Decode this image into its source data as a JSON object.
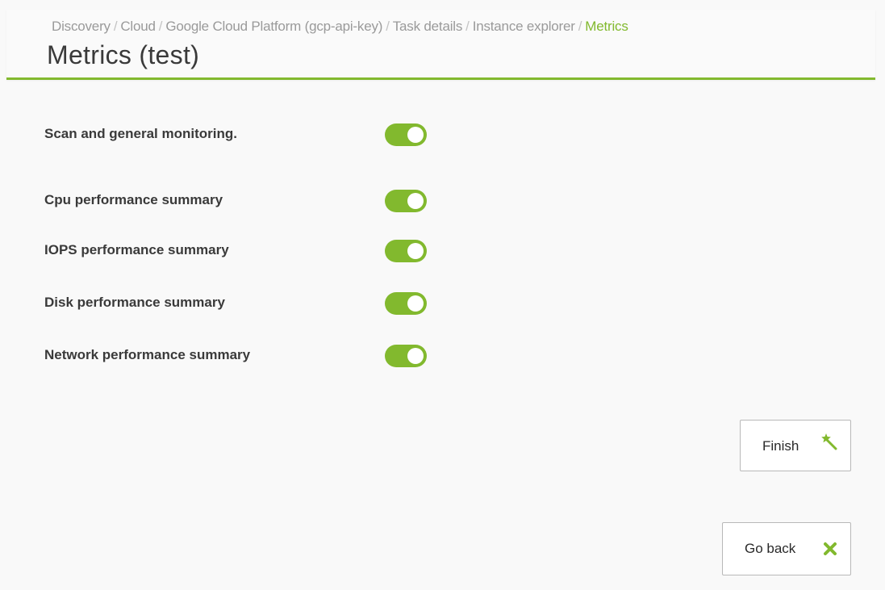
{
  "breadcrumb": {
    "items": [
      "Discovery",
      "Cloud",
      "Google Cloud Platform (gcp-api-key)",
      "Task details",
      "Instance explorer",
      "Metrics"
    ],
    "separator": "/"
  },
  "page_title": "Metrics (test)",
  "settings": [
    {
      "label": "Scan and general monitoring.",
      "enabled": true
    },
    {
      "label": "Cpu performance summary",
      "enabled": true
    },
    {
      "label": "IOPS performance summary",
      "enabled": true
    },
    {
      "label": "Disk performance summary",
      "enabled": true
    },
    {
      "label": "Network performance summary",
      "enabled": true
    }
  ],
  "buttons": {
    "finish": {
      "label": "Finish",
      "icon": "magic-wand-icon"
    },
    "go_back": {
      "label": "Go back",
      "icon": "cross-icon"
    }
  },
  "colors": {
    "accent": "#82b92e",
    "text": "#3a3a3a",
    "breadcrumb": "#9a9a9a"
  }
}
